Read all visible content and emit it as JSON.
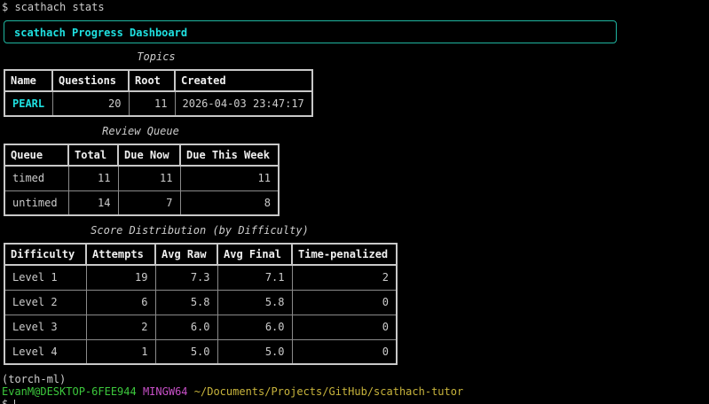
{
  "command_line": "$ scathach stats",
  "dashboard_title": "scathach Progress Dashboard",
  "topics": {
    "caption": "Topics",
    "headers": [
      "Name",
      "Questions",
      "Root",
      "Created"
    ],
    "rows": [
      [
        "PEARL",
        "20",
        "11",
        "2026-04-03 23:47:17"
      ]
    ]
  },
  "review_queue": {
    "caption": "Review Queue",
    "headers": [
      "Queue",
      "Total",
      "Due Now",
      "Due This Week"
    ],
    "rows": [
      [
        "timed",
        "11",
        "11",
        "11"
      ],
      [
        "untimed",
        "14",
        "7",
        "8"
      ]
    ]
  },
  "score_distribution": {
    "caption": "Score Distribution (by Difficulty)",
    "headers": [
      "Difficulty",
      "Attempts",
      "Avg Raw",
      "Avg Final",
      "Time-penalized"
    ],
    "rows": [
      [
        "Level 1",
        "19",
        "7.3",
        "7.1",
        "2"
      ],
      [
        "Level 2",
        "6",
        "5.8",
        "5.8",
        "0"
      ],
      [
        "Level 3",
        "2",
        "6.0",
        "6.0",
        "0"
      ],
      [
        "Level 4",
        "1",
        "5.0",
        "5.0",
        "0"
      ]
    ]
  },
  "env_line": "(torch-ml)",
  "prompt": {
    "user_host": "EvanM@DESKTOP-6FEE944",
    "shell": "MINGW64",
    "path": "~/Documents/Projects/GitHub/scathach-tutor",
    "symbol": "$"
  },
  "colors": {
    "background": "#000000",
    "accent_cyan": "#1fe0e0",
    "panel_border": "#1fb5a0",
    "prompt_green": "#3cc83c",
    "prompt_magenta": "#c850c8",
    "prompt_yellow": "#c8b43c"
  }
}
